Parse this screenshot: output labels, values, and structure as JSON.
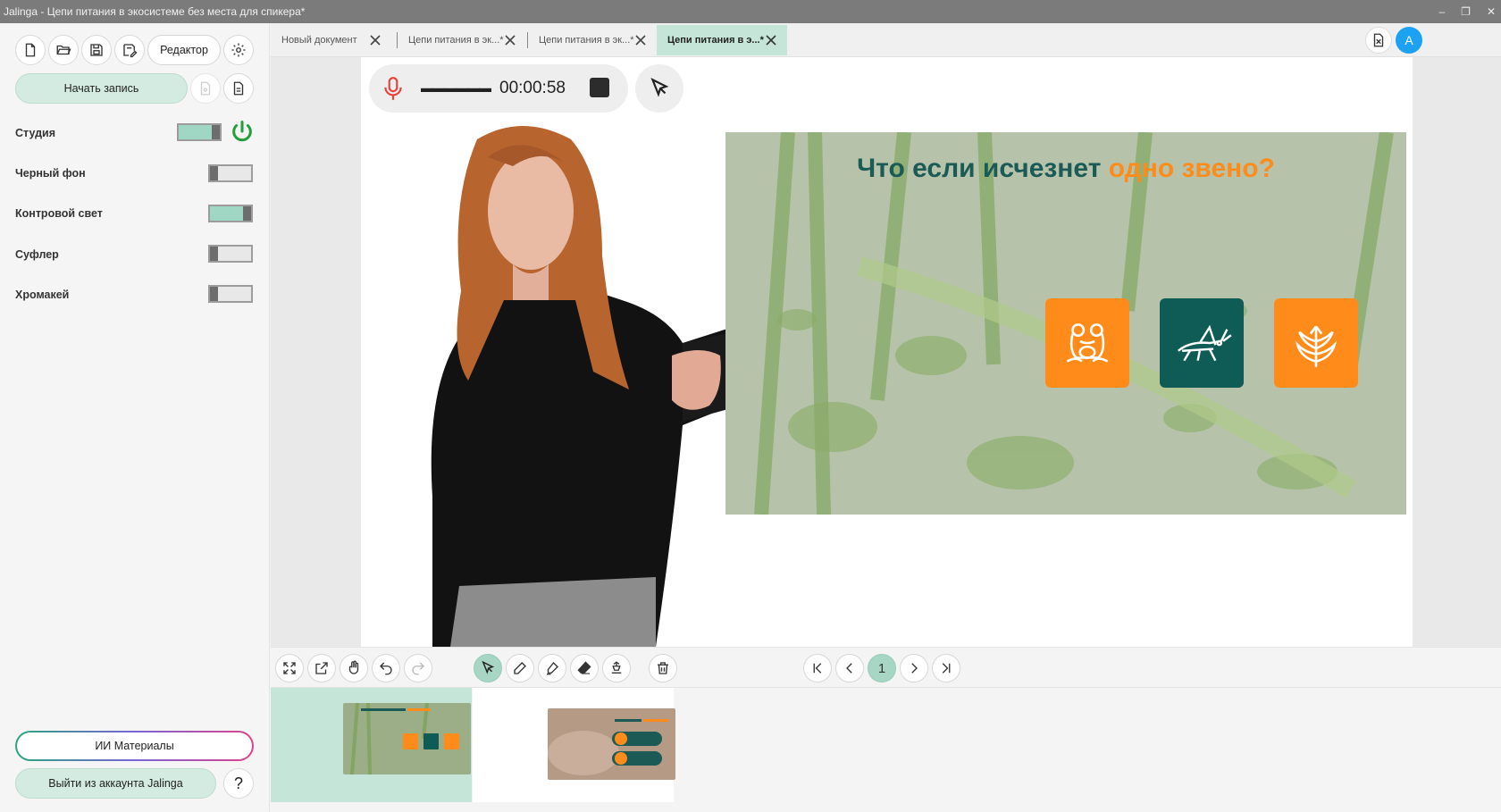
{
  "window": {
    "title": "Jalinga - Цепи питания в экосистеме без места для спикера*",
    "controls": [
      "–",
      "❐",
      "✕"
    ]
  },
  "sidebar": {
    "editor_label": "Редактор",
    "record_label": "Начать запись",
    "toggles": [
      {
        "label": "Студия",
        "on": true
      },
      {
        "label": "Черный фон",
        "on": false
      },
      {
        "label": "Контровой свет",
        "on": true
      },
      {
        "label": "Суфлер",
        "on": false
      },
      {
        "label": "Хромакей",
        "on": false
      }
    ],
    "ai_label": "ИИ Материалы",
    "logout_label": "Выйти из аккаунта Jalinga",
    "help_label": "?"
  },
  "tabs": [
    {
      "label": "Новый документ",
      "active": false
    },
    {
      "label": "Цепи питания в эк...*",
      "active": false
    },
    {
      "label": "Цепи питания в эк...*",
      "active": false
    },
    {
      "label": "Цепи питания в э...*",
      "active": true
    }
  ],
  "header_right": {
    "avatar_letter": "A"
  },
  "recorder": {
    "timer": "00:00:58",
    "level": "▬▬▬▬▬▬"
  },
  "slide": {
    "title_main": "Что если исчезнет ",
    "title_accent": "одно звено?",
    "tiles": [
      {
        "icon": "frog-icon",
        "color": "#ff8c1a"
      },
      {
        "icon": "grasshopper-icon",
        "color": "#0f5c56"
      },
      {
        "icon": "plant-icon",
        "color": "#ff8c1a"
      }
    ]
  },
  "pager": {
    "current_page": "1"
  },
  "colors": {
    "accent_green": "#a7d6c4",
    "slide_orange": "#ff8c1a",
    "slide_teal": "#1c5a55",
    "power_green": "#23a03a"
  }
}
